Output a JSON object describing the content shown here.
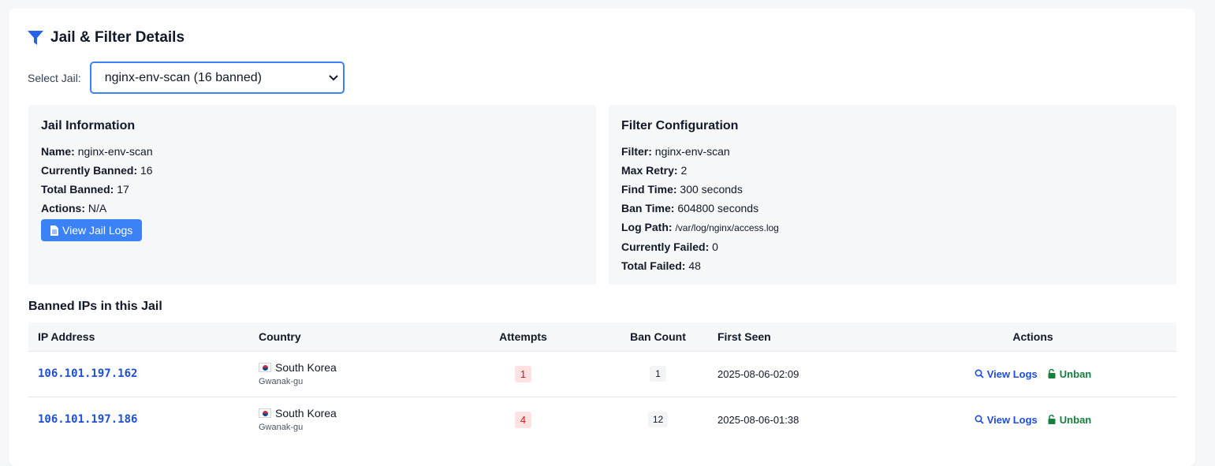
{
  "header": {
    "title": "Jail & Filter Details"
  },
  "select": {
    "label": "Select Jail:",
    "value": "nginx-env-scan (16 banned)"
  },
  "jail_info": {
    "title": "Jail Information",
    "name_label": "Name:",
    "name": "nginx-env-scan",
    "current_label": "Currently Banned:",
    "current": "16",
    "total_label": "Total Banned:",
    "total": "17",
    "actions_label": "Actions:",
    "actions": "N/A",
    "button": "View Jail Logs"
  },
  "filter_config": {
    "title": "Filter Configuration",
    "filter_label": "Filter:",
    "filter": "nginx-env-scan",
    "maxretry_label": "Max Retry:",
    "maxretry": "2",
    "findtime_label": "Find Time:",
    "findtime": "300 seconds",
    "bantime_label": "Ban Time:",
    "bantime": "604800 seconds",
    "logpath_label": "Log Path:",
    "logpath": "/var/log/nginx/access.log",
    "curfailed_label": "Currently Failed:",
    "curfailed": "0",
    "totalfailed_label": "Total Failed:",
    "totalfailed": "48"
  },
  "banned": {
    "title": "Banned IPs in this Jail",
    "columns": [
      "IP Address",
      "Country",
      "Attempts",
      "Ban Count",
      "First Seen",
      "Actions"
    ],
    "rows": [
      {
        "ip": "106.101.197.162",
        "country": "South Korea",
        "city": "Gwanak-gu",
        "attempts": "1",
        "ban_count": "1",
        "first_seen": "2025-08-06-02:09",
        "view_logs": "View Logs",
        "unban": "Unban"
      },
      {
        "ip": "106.101.197.186",
        "country": "South Korea",
        "city": "Gwanak-gu",
        "attempts": "4",
        "ban_count": "12",
        "first_seen": "2025-08-06-01:38",
        "view_logs": "View Logs",
        "unban": "Unban"
      }
    ]
  },
  "colors": {
    "accent": "#3b82f6",
    "link": "#1d4ed8",
    "unban": "#15803d",
    "attempts_bg": "#fee2e2",
    "attempts_fg": "#b91c1c"
  },
  "icons": {
    "title": "filter-icon",
    "button": "file-icon",
    "view_logs": "search-icon",
    "unban": "unlock-icon",
    "select": "chevron-down-icon",
    "country": "south-korea-flag-icon"
  }
}
